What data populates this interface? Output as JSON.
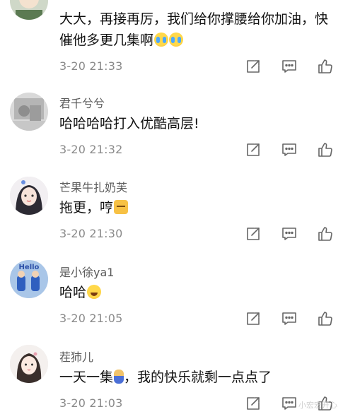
{
  "comments": [
    {
      "username": "",
      "text": "大大，再接再厉，我们给你撑腰给你加油，快催他多更几集啊",
      "emojis": [
        "crying-face-emoji",
        "crying-face-emoji"
      ],
      "time": "3-20 21:33"
    },
    {
      "username": "君千兮兮",
      "text": "哈哈哈哈打入优酷高层!",
      "emojis": [],
      "time": "3-20 21:32"
    },
    {
      "username": "芒果牛扎奶芙",
      "text": "拖更，哼",
      "emojis": [
        "cat-face-emoji"
      ],
      "time": "3-20 21:30"
    },
    {
      "username": "是小徐ya1",
      "text": "哈哈",
      "emojis": [
        "laughing-face-emoji"
      ],
      "time": "3-20 21:05"
    },
    {
      "username": "茬犻儿",
      "text_before": "一天一集",
      "text_after": "，我的快乐就剩一点点了",
      "emojis": [
        "figure-emoji"
      ],
      "time": "3-20 21:03"
    }
  ],
  "avatars": {
    "avatar_4_text": "Hello"
  },
  "icons": {
    "share": "share-icon",
    "reply": "comment-icon",
    "like": "thumbs-up-icon"
  },
  "watermark": "小宏宏开心"
}
